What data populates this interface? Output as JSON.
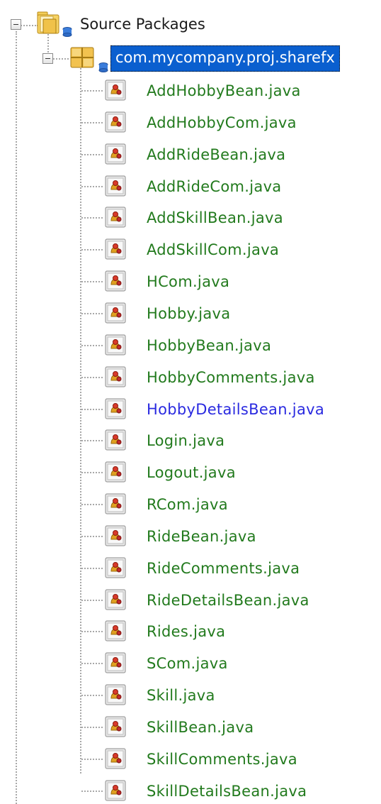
{
  "tree": {
    "root": {
      "label": "Source Packages",
      "icon": "source-packages-folder-icon"
    },
    "package": {
      "label": "com.mycompany.proj.sharefx",
      "icon": "java-package-icon",
      "selected": true,
      "colors": {
        "selection_bg": "#0a5fcf",
        "selection_text": "#ffffff"
      }
    },
    "files": [
      {
        "label": "AddHobbyBean.java",
        "status": "new"
      },
      {
        "label": "AddHobbyCom.java",
        "status": "new"
      },
      {
        "label": "AddRideBean.java",
        "status": "new"
      },
      {
        "label": "AddRideCom.java",
        "status": "new"
      },
      {
        "label": "AddSkillBean.java",
        "status": "new"
      },
      {
        "label": "AddSkillCom.java",
        "status": "new"
      },
      {
        "label": "HCom.java",
        "status": "new"
      },
      {
        "label": "Hobby.java",
        "status": "new"
      },
      {
        "label": "HobbyBean.java",
        "status": "new"
      },
      {
        "label": "HobbyComments.java",
        "status": "new"
      },
      {
        "label": "HobbyDetailsBean.java",
        "status": "modified"
      },
      {
        "label": "Login.java",
        "status": "new"
      },
      {
        "label": "Logout.java",
        "status": "new"
      },
      {
        "label": "RCom.java",
        "status": "new"
      },
      {
        "label": "RideBean.java",
        "status": "new"
      },
      {
        "label": "RideComments.java",
        "status": "new"
      },
      {
        "label": "RideDetailsBean.java",
        "status": "new"
      },
      {
        "label": "Rides.java",
        "status": "new"
      },
      {
        "label": "SCom.java",
        "status": "new"
      },
      {
        "label": "Skill.java",
        "status": "new"
      },
      {
        "label": "SkillBean.java",
        "status": "new"
      },
      {
        "label": "SkillComments.java",
        "status": "new"
      },
      {
        "label": "SkillDetailsBean.java",
        "status": "new"
      }
    ],
    "file_icon": "java-class-icon",
    "colors": {
      "new_file": "#227a1d",
      "modified_file": "#2a2ae0"
    }
  }
}
